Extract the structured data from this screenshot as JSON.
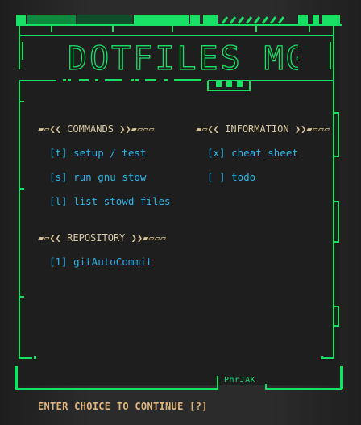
{
  "colors": {
    "frame_green": "#17e065",
    "dark_green": "#0a5a2a",
    "menu_blue": "#2db4e8",
    "section_text": "#d6c8a3",
    "prompt_amber": "#e0b57c"
  },
  "title": "DOTFILES MGMT",
  "sections": [
    {
      "title": "COMMANDS",
      "deco_left": "▰▱❮❮",
      "deco_right": "❯❯▰▱▱▱",
      "items": [
        {
          "key": "[t]",
          "label": "setup / test"
        },
        {
          "key": "[s]",
          "label": "run gnu stow"
        },
        {
          "key": "[l]",
          "label": "list stowd files"
        }
      ]
    },
    {
      "title": "INFORMATION",
      "deco_left": "▰▱❮❮",
      "deco_right": "❯❯▰▱▱▱",
      "items": [
        {
          "key": "[x]",
          "label": "cheat sheet"
        },
        {
          "key": "[ ]",
          "label": "todo"
        }
      ]
    },
    {
      "title": "REPOSITORY",
      "deco_left": "▰▱❮❮",
      "deco_right": "❯❯▰▱▱▱",
      "items": [
        {
          "key": "[1]",
          "label": "gitAutoCommit"
        }
      ]
    }
  ],
  "signature": "PhrJAK",
  "prompt": "ENTER CHOICE TO CONTINUE [?]"
}
